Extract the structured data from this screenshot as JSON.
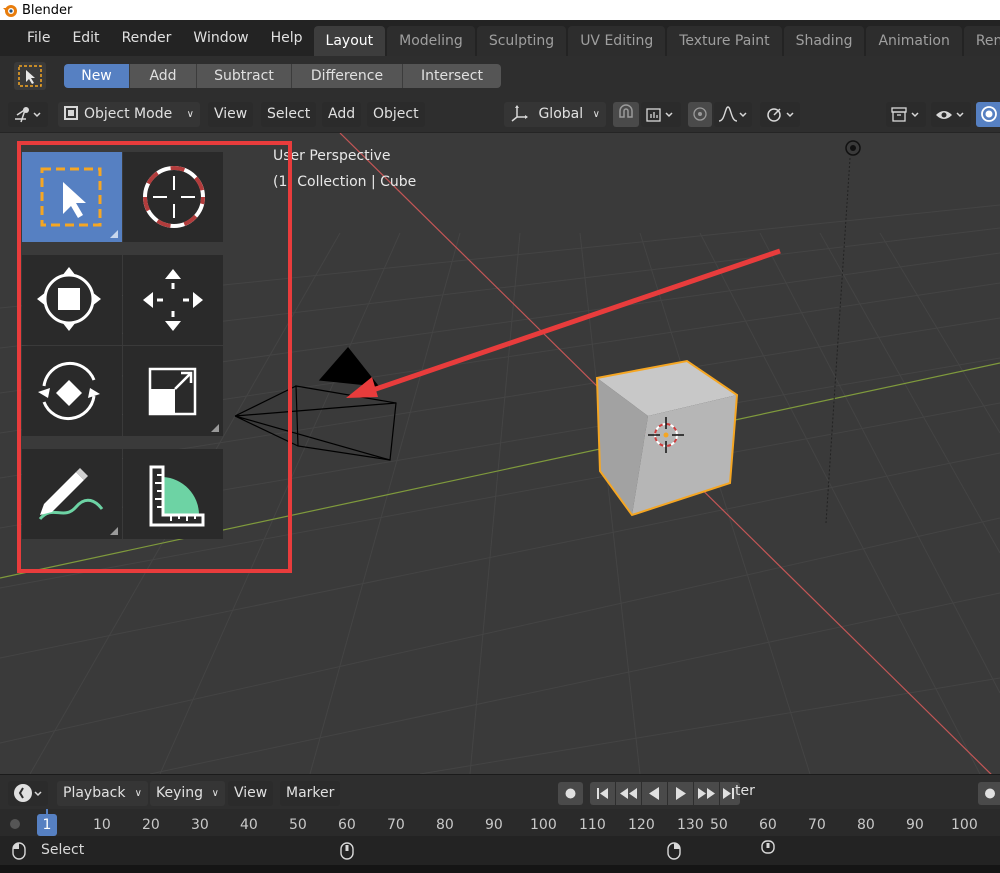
{
  "window": {
    "title": "Blender"
  },
  "topbar": {
    "menus": [
      "File",
      "Edit",
      "Render",
      "Window",
      "Help"
    ],
    "tabs": [
      {
        "label": "Layout",
        "active": true
      },
      {
        "label": "Modeling"
      },
      {
        "label": "Sculpting"
      },
      {
        "label": "UV Editing"
      },
      {
        "label": "Texture Paint"
      },
      {
        "label": "Shading"
      },
      {
        "label": "Animation"
      },
      {
        "label": "Ren"
      }
    ]
  },
  "tool_header": {
    "modes": [
      {
        "label": "New",
        "active": true
      },
      {
        "label": "Add"
      },
      {
        "label": "Subtract"
      },
      {
        "label": "Difference"
      },
      {
        "label": "Intersect"
      }
    ]
  },
  "viewport_header": {
    "mode": "Object Mode",
    "menus": [
      "View",
      "Select",
      "Add",
      "Object"
    ],
    "orientation": "Global"
  },
  "viewport": {
    "overlay_line1": "User Perspective",
    "overlay_line2": "(1) Collection | Cube",
    "tools": [
      "select-box-icon",
      "cursor-icon",
      "transform-icon",
      "move-icon",
      "rotate-icon",
      "scale-icon",
      "annotate-icon",
      "measure-icon"
    ],
    "highlight_color": "#e83c3c",
    "active_tool_color": "#5680c2",
    "selection_outline_color": "#f5a623"
  },
  "timeline": {
    "menus": [
      "Playback",
      "Keying",
      "View",
      "Marker"
    ],
    "partial_label": "ter",
    "current_frame": "1",
    "ticks_left": [
      "10",
      "20",
      "30",
      "40",
      "50",
      "60",
      "70",
      "80",
      "90",
      "100",
      "110",
      "120",
      "130"
    ],
    "ticks_right": [
      "50",
      "60",
      "70",
      "80",
      "90",
      "100"
    ]
  },
  "statusbar": {
    "label": "Select"
  }
}
